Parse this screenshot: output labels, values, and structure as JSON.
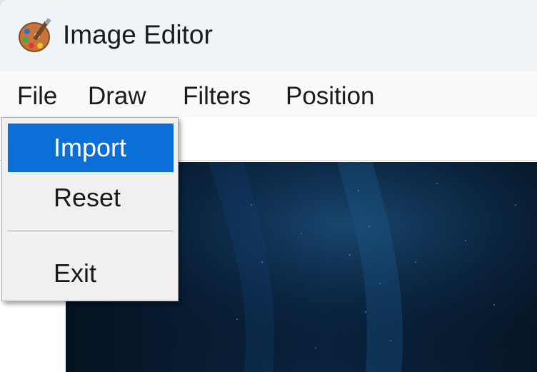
{
  "window": {
    "title": "Image Editor",
    "app_icon": "palette-icon"
  },
  "menubar": {
    "items": [
      {
        "label": "File"
      },
      {
        "label": "Draw"
      },
      {
        "label": "Filters"
      },
      {
        "label": "Position"
      }
    ]
  },
  "file_menu": {
    "items": [
      {
        "label": "Import",
        "highlighted": true
      },
      {
        "label": "Reset"
      },
      {
        "label": "Exit"
      }
    ]
  },
  "colors": {
    "highlight": "#0a6fd6",
    "image_bg": "#061424",
    "titlebar": "#eff4f9"
  }
}
